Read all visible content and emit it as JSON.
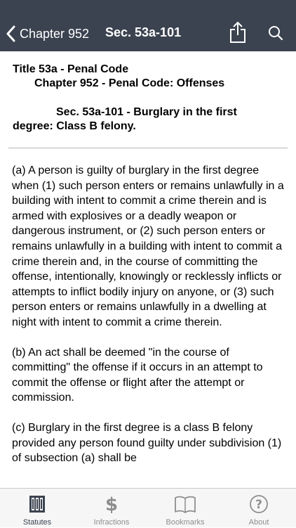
{
  "navbar": {
    "back_label": "Chapter 952",
    "title": "Sec. 53a-101"
  },
  "heading": {
    "title_line": "Title 53a - Penal Code",
    "chapter_line": "Chapter 952 - Penal Code: Offenses",
    "section_line1": "Sec. 53a-101 - Burglary in the first",
    "section_line2": "degree: Class B felony."
  },
  "body": {
    "para_a": "(a) A person is guilty of burglary in the first degree when (1) such person enters or remains unlawfully in a building with intent to commit a crime therein and is armed with explosives or a deadly weapon or dangerous instrument, or (2) such person enters or remains unlawfully in a building with intent to commit a crime therein and, in the course of committing the offense, intentionally, knowingly or recklessly inflicts or attempts to inflict bodily injury on anyone, or (3) such person enters or remains unlawfully in a dwelling at night with intent to commit a crime therein.",
    "para_b": "(b) An act shall be deemed \"in the course of committing\" the offense if it occurs in an attempt to commit the offense or flight after the attempt or commission.",
    "para_c": "(c) Burglary in the first degree is a class B felony provided any person found guilty under subdivision (1) of subsection (a) shall be"
  },
  "tabs": [
    {
      "label": "Statutes",
      "icon": "book-columns-icon",
      "active": true
    },
    {
      "label": "Infractions",
      "icon": "dollar-icon",
      "active": false
    },
    {
      "label": "Bookmarks",
      "icon": "open-book-icon",
      "active": false
    },
    {
      "label": "About",
      "icon": "question-circle-icon",
      "active": false
    }
  ],
  "colors": {
    "navbar": "#3b4350",
    "tab_active": "#3b4350",
    "tab_inactive": "#8e8e8e"
  }
}
